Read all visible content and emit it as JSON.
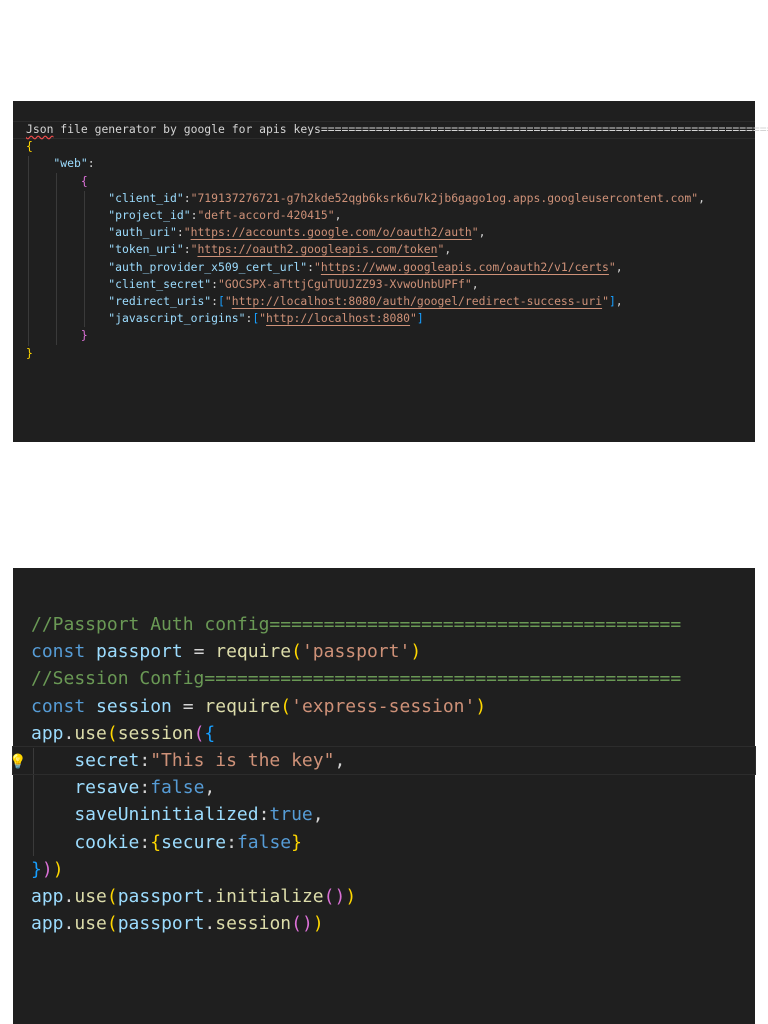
{
  "json_panel": {
    "lines": [
      [
        {
          "t": "Json",
          "k": "pl err"
        },
        {
          "t": " file generator by google for apis keys===================================================================",
          "k": "pl"
        }
      ],
      [
        {
          "t": "{",
          "k": "b1"
        }
      ],
      [
        {
          "t": "    \"web\"",
          "k": "var"
        },
        {
          "t": ":",
          "k": "pl"
        }
      ],
      [
        {
          "t": "        ",
          "k": "pl"
        },
        {
          "t": "{",
          "k": "b2"
        }
      ],
      [
        {
          "t": "            \"client_id\"",
          "k": "var"
        },
        {
          "t": ":",
          "k": "pl"
        },
        {
          "t": "\"719137276721-g7h2kde52qgb6ksrk6u7k2jb6gago1og.apps.googleusercontent.com\"",
          "k": "str"
        },
        {
          "t": ",",
          "k": "pl"
        }
      ],
      [
        {
          "t": "            \"project_id\"",
          "k": "var"
        },
        {
          "t": ":",
          "k": "pl"
        },
        {
          "t": "\"deft-accord-420415\"",
          "k": "str"
        },
        {
          "t": ",",
          "k": "pl"
        }
      ],
      [
        {
          "t": "            \"auth_uri\"",
          "k": "var"
        },
        {
          "t": ":",
          "k": "pl"
        },
        {
          "t": "\"",
          "k": "str"
        },
        {
          "t": "https://accounts.google.com/o/oauth2/auth",
          "k": "url"
        },
        {
          "t": "\"",
          "k": "str"
        },
        {
          "t": ",",
          "k": "pl"
        }
      ],
      [
        {
          "t": "            \"token_uri\"",
          "k": "var"
        },
        {
          "t": ":",
          "k": "pl"
        },
        {
          "t": "\"",
          "k": "str"
        },
        {
          "t": "https://oauth2.googleapis.com/token",
          "k": "url"
        },
        {
          "t": "\"",
          "k": "str"
        },
        {
          "t": ",",
          "k": "pl"
        }
      ],
      [
        {
          "t": "            \"auth_provider_x509_cert_url\"",
          "k": "var"
        },
        {
          "t": ":",
          "k": "pl"
        },
        {
          "t": "\"",
          "k": "str"
        },
        {
          "t": "https://www.googleapis.com/oauth2/v1/certs",
          "k": "url"
        },
        {
          "t": "\"",
          "k": "str"
        },
        {
          "t": ",",
          "k": "pl"
        }
      ],
      [
        {
          "t": "            \"client_secret\"",
          "k": "var"
        },
        {
          "t": ":",
          "k": "pl"
        },
        {
          "t": "\"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\"",
          "k": "str"
        },
        {
          "t": ",",
          "k": "pl"
        }
      ],
      [
        {
          "t": "            \"redirect_uris\"",
          "k": "var"
        },
        {
          "t": ":",
          "k": "pl"
        },
        {
          "t": "[",
          "k": "b3"
        },
        {
          "t": "\"",
          "k": "str"
        },
        {
          "t": "http://localhost:8080/auth/googel/redirect-success-uri",
          "k": "url"
        },
        {
          "t": "\"",
          "k": "str"
        },
        {
          "t": "]",
          "k": "b3"
        },
        {
          "t": ",",
          "k": "pl"
        }
      ],
      [
        {
          "t": "            \"javascript_origins\"",
          "k": "var"
        },
        {
          "t": ":",
          "k": "pl"
        },
        {
          "t": "[",
          "k": "b3"
        },
        {
          "t": "\"",
          "k": "str"
        },
        {
          "t": "http://localhost:8080",
          "k": "url"
        },
        {
          "t": "\"",
          "k": "str"
        },
        {
          "t": "]",
          "k": "b3"
        }
      ],
      [
        {
          "t": "        ",
          "k": "pl"
        },
        {
          "t": "}",
          "k": "b2"
        }
      ],
      [
        {
          "t": "}",
          "k": "b1"
        }
      ]
    ]
  },
  "js_panel": {
    "lines": [
      [
        {
          "t": "//Passport Auth config======================================",
          "k": "cm"
        }
      ],
      [
        {
          "t": "const",
          "k": "kw"
        },
        {
          "t": " ",
          "k": "pl"
        },
        {
          "t": "passport",
          "k": "var"
        },
        {
          "t": " = ",
          "k": "pl"
        },
        {
          "t": "require",
          "k": "fn"
        },
        {
          "t": "(",
          "k": "b1"
        },
        {
          "t": "'passport'",
          "k": "str"
        },
        {
          "t": ")",
          "k": "b1"
        }
      ],
      [
        {
          "t": "//Session Config============================================",
          "k": "cm"
        }
      ],
      [
        {
          "t": "const",
          "k": "kw"
        },
        {
          "t": " ",
          "k": "pl"
        },
        {
          "t": "session",
          "k": "var"
        },
        {
          "t": " = ",
          "k": "pl"
        },
        {
          "t": "require",
          "k": "fn"
        },
        {
          "t": "(",
          "k": "b1"
        },
        {
          "t": "'express-session'",
          "k": "str"
        },
        {
          "t": ")",
          "k": "b1"
        }
      ],
      [
        {
          "t": "app",
          "k": "var"
        },
        {
          "t": ".",
          "k": "pl"
        },
        {
          "t": "use",
          "k": "fn"
        },
        {
          "t": "(",
          "k": "b1"
        },
        {
          "t": "session",
          "k": "fn"
        },
        {
          "t": "(",
          "k": "b2"
        },
        {
          "t": "{",
          "k": "b3"
        }
      ],
      [
        {
          "t": "    secret",
          "k": "var"
        },
        {
          "t": ":",
          "k": "pl"
        },
        {
          "t": "\"This is the key\"",
          "k": "str"
        },
        {
          "t": ",",
          "k": "pl"
        }
      ],
      [
        {
          "t": "    resave",
          "k": "var"
        },
        {
          "t": ":",
          "k": "pl"
        },
        {
          "t": "false",
          "k": "kw"
        },
        {
          "t": ",",
          "k": "pl"
        }
      ],
      [
        {
          "t": "    saveUninitialized",
          "k": "var"
        },
        {
          "t": ":",
          "k": "pl"
        },
        {
          "t": "true",
          "k": "kw"
        },
        {
          "t": ",",
          "k": "pl"
        }
      ],
      [
        {
          "t": "    cookie",
          "k": "var"
        },
        {
          "t": ":",
          "k": "pl"
        },
        {
          "t": "{",
          "k": "b1"
        },
        {
          "t": "secure",
          "k": "var"
        },
        {
          "t": ":",
          "k": "pl"
        },
        {
          "t": "false",
          "k": "kw"
        },
        {
          "t": "}",
          "k": "b1"
        }
      ],
      [
        {
          "t": "}",
          "k": "b3"
        },
        {
          "t": ")",
          "k": "b2"
        },
        {
          "t": ")",
          "k": "b1"
        }
      ],
      [
        {
          "t": "app",
          "k": "var"
        },
        {
          "t": ".",
          "k": "pl"
        },
        {
          "t": "use",
          "k": "fn"
        },
        {
          "t": "(",
          "k": "b1"
        },
        {
          "t": "passport",
          "k": "var"
        },
        {
          "t": ".",
          "k": "pl"
        },
        {
          "t": "initialize",
          "k": "fn"
        },
        {
          "t": "()",
          "k": "b2"
        },
        {
          "t": ")",
          "k": "b1"
        }
      ],
      [
        {
          "t": "app",
          "k": "var"
        },
        {
          "t": ".",
          "k": "pl"
        },
        {
          "t": "use",
          "k": "fn"
        },
        {
          "t": "(",
          "k": "b1"
        },
        {
          "t": "passport",
          "k": "var"
        },
        {
          "t": ".",
          "k": "pl"
        },
        {
          "t": "session",
          "k": "fn"
        },
        {
          "t": "()",
          "k": "b2"
        },
        {
          "t": ")",
          "k": "b1"
        }
      ]
    ],
    "lightbulb_icon": "lightbulb-icon"
  }
}
